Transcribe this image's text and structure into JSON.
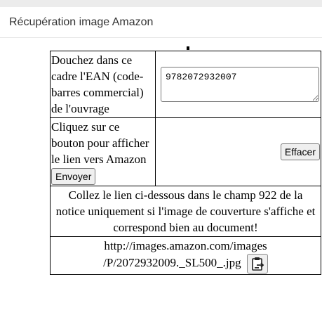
{
  "dialog": {
    "title": "Récupération image Amazon"
  },
  "ean_section": {
    "label": "Douchez dans ce cadre l'EAN (code-barres commercial) de l'ouvrage",
    "ean_value": "9782072932007"
  },
  "send_section": {
    "label": "Cliquez sur ce bouton pour afficher le lien vers Amazon",
    "send_button": "Envoyer",
    "clear_button": "Effacer"
  },
  "instructions": {
    "text": "Collez le lien ci-dessous dans le champ 922 de la notice uniquement si l'image de couverture s'affiche et correspond bien au document!"
  },
  "link": {
    "line1": "http://images.amazon.com/images",
    "line2": "/P/2072932009._SL500_.jpg",
    "copy_icon": "clipboard-copy-icon"
  }
}
